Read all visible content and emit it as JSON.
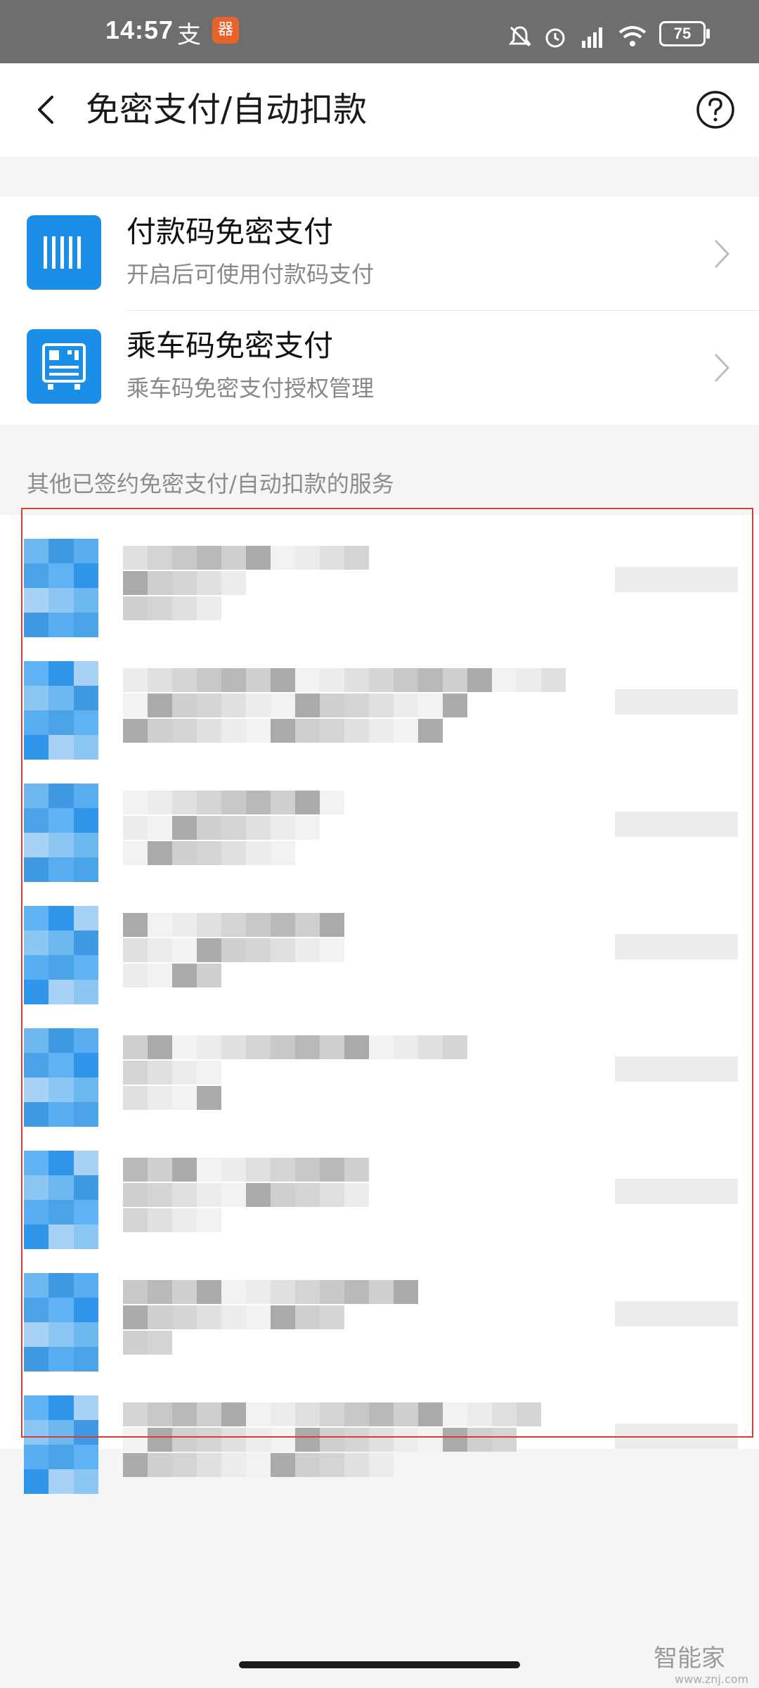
{
  "status_bar": {
    "time": "14:57",
    "alipay_glyph": "支",
    "app_badge": "器",
    "battery": "75"
  },
  "header": {
    "title": "免密支付/自动扣款",
    "back_icon": "back-arrow-icon",
    "help_icon": "help-circle-icon"
  },
  "services": [
    {
      "title": "付款码免密支付",
      "subtitle": "开启后可使用付款码支付",
      "icon": "barcode-icon"
    },
    {
      "title": "乘车码免密支付",
      "subtitle": "乘车码免密支付授权管理",
      "icon": "bus-qr-icon"
    }
  ],
  "section": {
    "label": "其他已签约免密支付/自动扣款的服务"
  },
  "watermark": {
    "text": "智能家",
    "sub": "www.znj.com"
  },
  "colors": {
    "accent": "#1b8fe8",
    "highlight_border": "#d0403a"
  }
}
